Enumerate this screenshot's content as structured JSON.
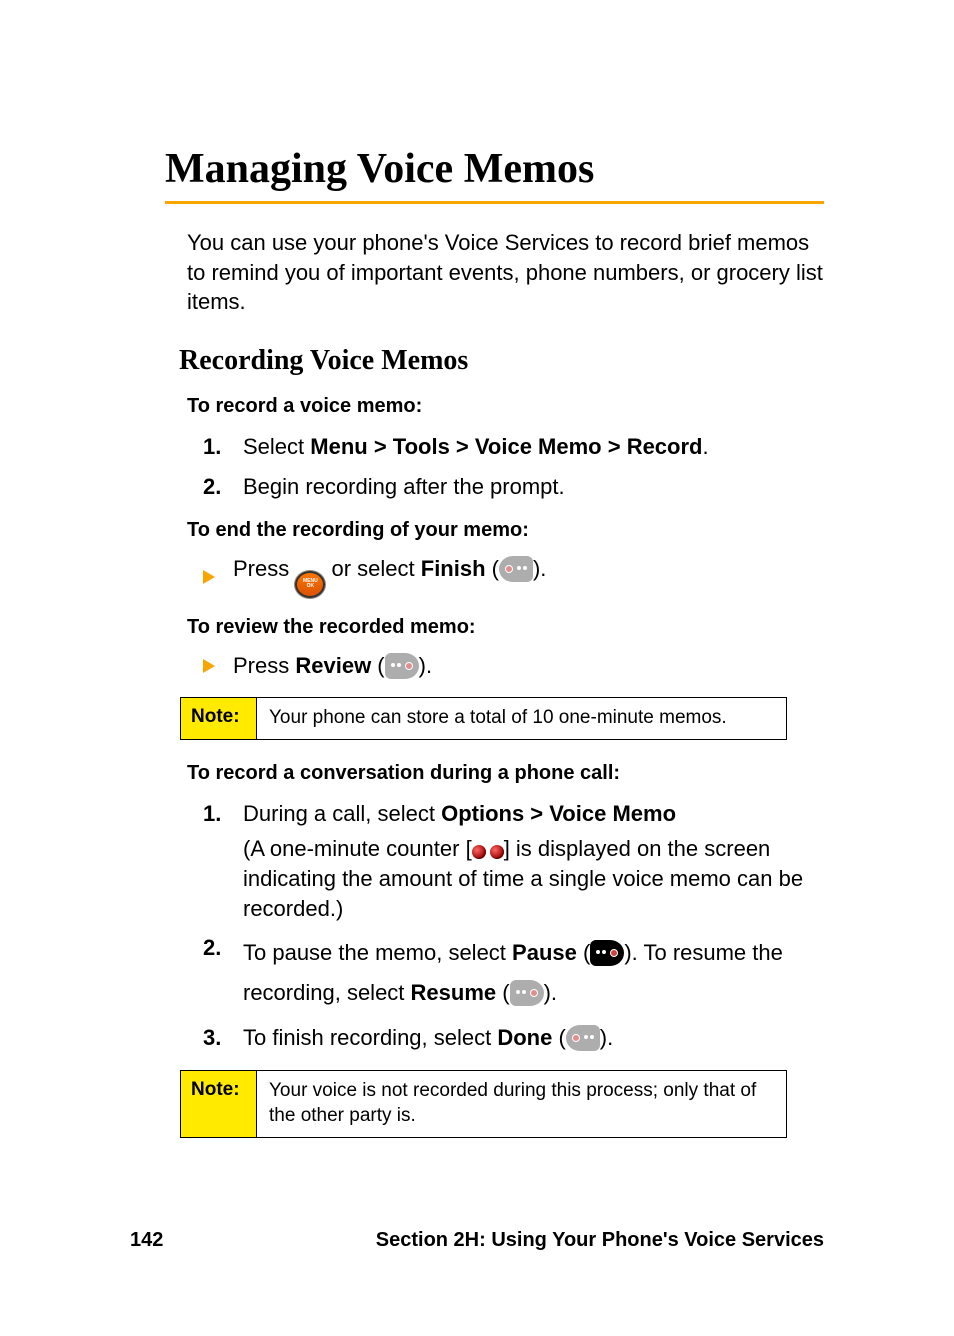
{
  "title": "Managing Voice Memos",
  "intro": "You can use your phone's Voice Services to record brief memos to remind you of important events, phone numbers, or grocery list items.",
  "subhead": "Recording Voice Memos",
  "sec1": {
    "lead": "To record a voice memo:",
    "steps": [
      {
        "num": "1.",
        "pre": "Select ",
        "bold": "Menu > Tools > Voice Memo > Record",
        "post": "."
      },
      {
        "num": "2.",
        "text": "Begin recording after the prompt."
      }
    ]
  },
  "sec2": {
    "lead": "To end the recording of your memo:",
    "bullet": {
      "t1": "Press ",
      "t2": " or select ",
      "bold": "Finish",
      "t3": " (",
      "t4": ")."
    }
  },
  "sec3": {
    "lead": "To review the recorded memo:",
    "bullet": {
      "t1": "Press ",
      "bold": "Review",
      "t2": " (",
      "t3": ")."
    }
  },
  "note1": {
    "label": "Note:",
    "text": "Your phone can store a total of 10 one-minute memos."
  },
  "sec4": {
    "lead": "To record a conversation during a phone call:",
    "steps": [
      {
        "num": "1.",
        "pre": "During a call, select ",
        "bold": "Options > Voice Memo",
        "sub_a": "(A one-minute counter [",
        "sub_b": "] is displayed on the screen indicating the amount of time a single voice memo can be recorded.)"
      },
      {
        "num": "2.",
        "t1": "To pause the memo, select ",
        "b1": "Pause",
        "t2": " (",
        "t3": "). To resume the recording, select ",
        "b2": "Resume",
        "t4": " (",
        "t5": ")."
      },
      {
        "num": "3.",
        "t1": "To finish recording, select ",
        "b1": "Done",
        "t2": " (",
        "t3": ")."
      }
    ]
  },
  "note2": {
    "label": "Note:",
    "text": "Your voice is not recorded during this process; only that of the other party is."
  },
  "footer": {
    "page": "142",
    "section": "Section 2H: Using Your Phone's Voice Services"
  }
}
